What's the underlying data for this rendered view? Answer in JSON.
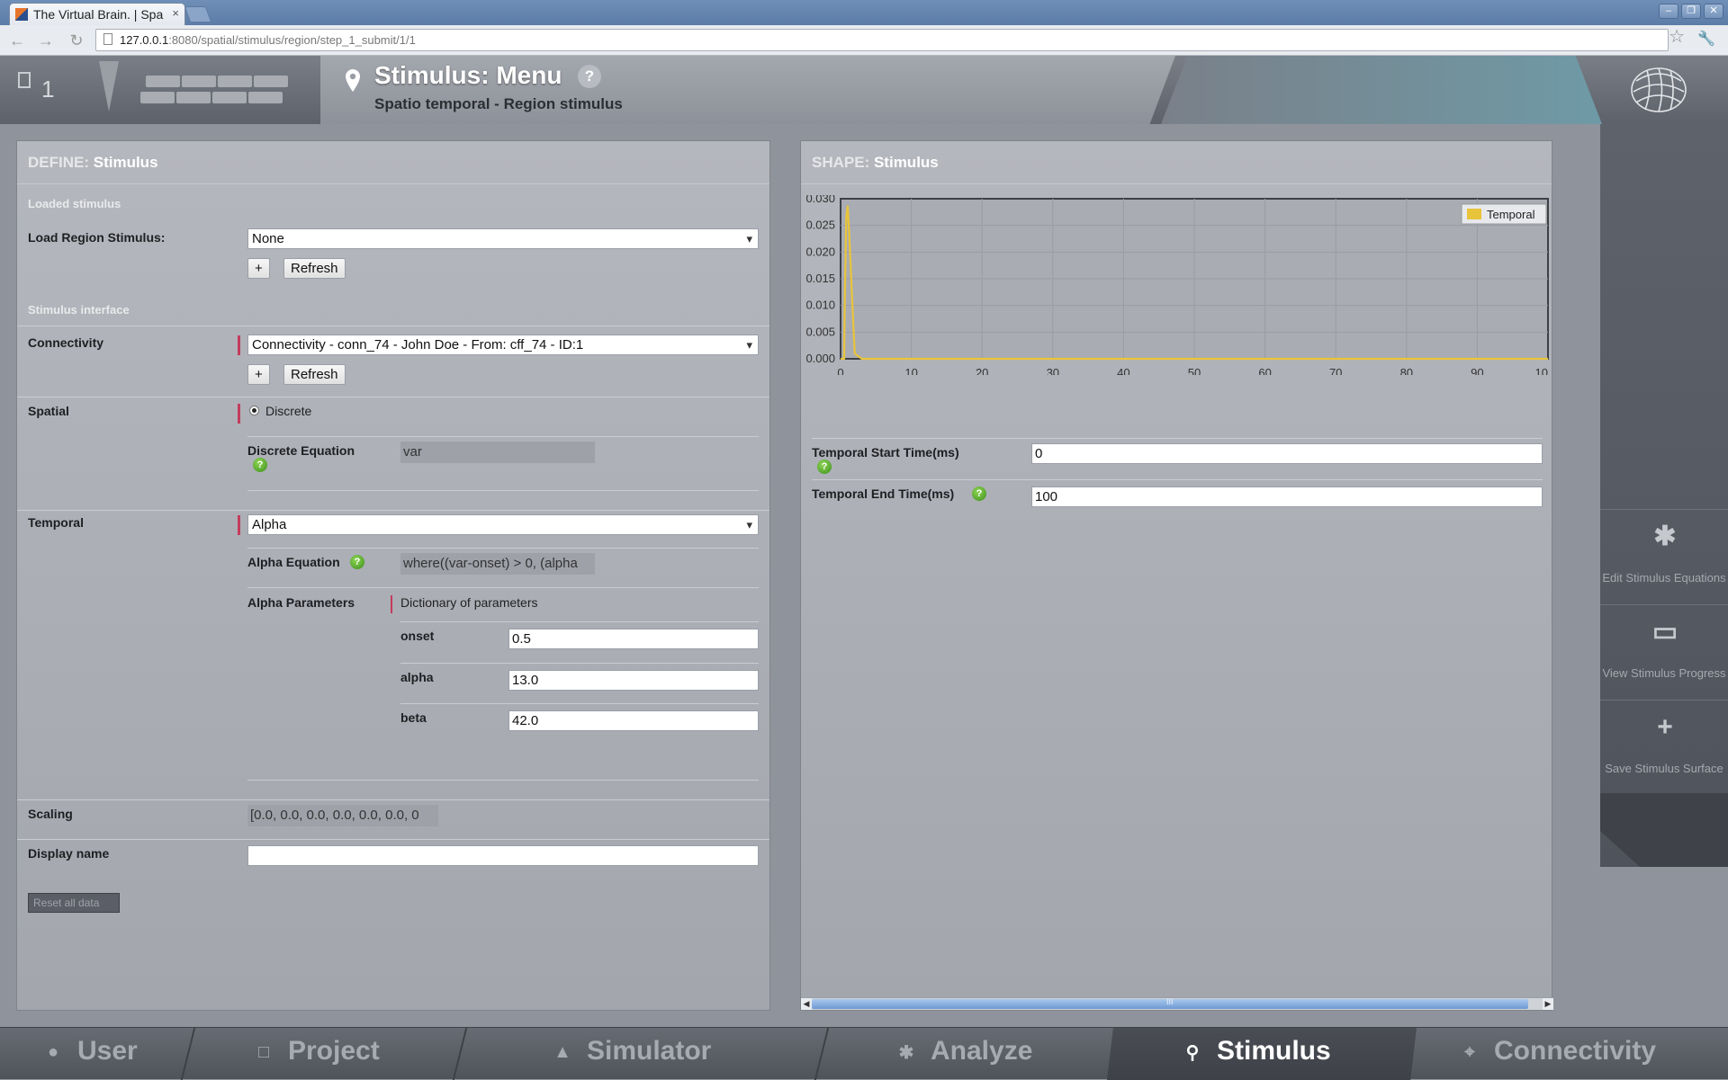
{
  "browser": {
    "tab_title": "The Virtual Brain. | Spa",
    "tab_close": "×",
    "url_host": "127.0.0.1",
    "url_path": ":8080/spatial/stimulus/region/step_1_submit/1/1"
  },
  "header": {
    "project_count": "1",
    "title": "Stimulus: Menu",
    "help": "?",
    "subtitle": "Spatio temporal - Region stimulus"
  },
  "define": {
    "heading_key": "DEFINE:",
    "heading_value": "Stimulus",
    "loaded_section": "Loaded stimulus",
    "load_label": "Load Region Stimulus:",
    "load_value": "None",
    "plus": "+",
    "refresh": "Refresh",
    "interface_section": "Stimulus interface",
    "connectivity_label": "Connectivity",
    "connectivity_value": "Connectivity - conn_74 - John Doe - From: cff_74 - ID:1",
    "spatial_label": "Spatial",
    "spatial_option": "Discrete",
    "discrete_eq_label": "Discrete Equation",
    "discrete_eq_value": "var",
    "temporal_label": "Temporal",
    "temporal_value": "Alpha",
    "alpha_eq_label": "Alpha Equation",
    "alpha_eq_value": "where((var-onset) > 0, (alpha",
    "alpha_params_label": "Alpha Parameters",
    "alpha_params_desc": "Dictionary of parameters",
    "params": [
      {
        "name": "onset",
        "value": "0.5"
      },
      {
        "name": "alpha",
        "value": "13.0"
      },
      {
        "name": "beta",
        "value": "42.0"
      }
    ],
    "scaling_label": "Scaling",
    "scaling_value": "[0.0, 0.0, 0.0, 0.0, 0.0, 0.0, 0",
    "display_name_label": "Display name",
    "display_name_value": "",
    "reset": "Reset all data"
  },
  "shape": {
    "heading_key": "SHAPE:",
    "heading_value": "Stimulus",
    "start_label": "Temporal Start Time(ms)",
    "start_value": "0",
    "end_label": "Temporal End Time(ms)",
    "end_value": "100",
    "scroll_grip": "III"
  },
  "chart_data": {
    "type": "line",
    "series": [
      {
        "name": "Temporal",
        "color": "#e8c43a",
        "x": [
          0,
          0.5,
          0.6,
          0.8,
          1.0,
          1.2,
          1.6,
          2,
          3,
          10,
          20,
          30,
          40,
          50,
          60,
          70,
          80,
          90,
          100
        ],
        "y": [
          0,
          0,
          0.0115,
          0.0265,
          0.0287,
          0.024,
          0.012,
          0.001,
          0,
          0,
          0,
          0,
          0,
          0,
          0,
          0,
          0,
          0,
          0
        ]
      }
    ],
    "xlim": [
      0,
      100
    ],
    "ylim": [
      0,
      0.03
    ],
    "xticks": [
      "0",
      "10",
      "20",
      "30",
      "40",
      "50",
      "60",
      "70",
      "80",
      "90",
      "10"
    ],
    "yticks": [
      "0.000",
      "0.005",
      "0.010",
      "0.015",
      "0.020",
      "0.025",
      "0.030"
    ],
    "grid": true,
    "legend": "top-right",
    "xlabel": "",
    "ylabel": "",
    "title": ""
  },
  "sidebar": {
    "items": [
      {
        "label": "Edit Stimulus Equations",
        "icon": "gear-icon"
      },
      {
        "label": "View Stimulus Progress",
        "icon": "monitor-icon"
      },
      {
        "label": "Save Stimulus Surface",
        "icon": "plus-icon"
      }
    ]
  },
  "bottomnav": {
    "items": [
      {
        "label": "User",
        "icon": "user-icon"
      },
      {
        "label": "Project",
        "icon": "document-icon"
      },
      {
        "label": "Simulator",
        "icon": "rocket-icon"
      },
      {
        "label": "Analyze",
        "icon": "gear-icon"
      },
      {
        "label": "Stimulus",
        "icon": "pin-icon"
      },
      {
        "label": "Connectivity",
        "icon": "network-icon"
      }
    ],
    "active": "Stimulus"
  }
}
